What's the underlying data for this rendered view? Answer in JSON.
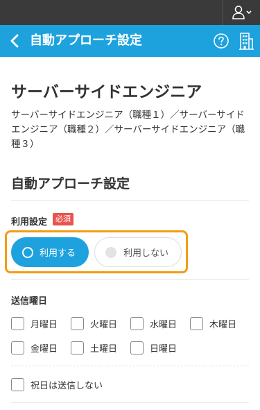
{
  "header": {
    "back_icon": "chevron-left-icon",
    "title": "自動アプローチ設定",
    "help_icon": "question-circle-icon",
    "company_icon": "building-icon",
    "account_icon": "user-chevron-icon"
  },
  "job": {
    "title": "サーバーサイドエンジニア",
    "categories": "サーバーサイドエンジニア（職種１）／サーバーサイドエンジニア（職種２）／サーバーサイドエンジニア（職種３）"
  },
  "settings": {
    "section_title": "自動アプローチ設定",
    "usage": {
      "label": "利用設定",
      "required_badge": "必須",
      "options": [
        {
          "label": "利用する",
          "selected": true
        },
        {
          "label": "利用しない",
          "selected": false
        }
      ]
    },
    "send_days": {
      "label": "送信曜日",
      "days": [
        "月曜日",
        "火曜日",
        "水曜日",
        "木曜日",
        "金曜日",
        "土曜日",
        "日曜日"
      ],
      "skip_holidays_label": "祝日は送信しない"
    }
  },
  "colors": {
    "header_bg": "#1ea2de",
    "topbar_bg": "#3a3a3a",
    "focus_outline": "#f39c12",
    "badge_bg": "#e8544e"
  }
}
